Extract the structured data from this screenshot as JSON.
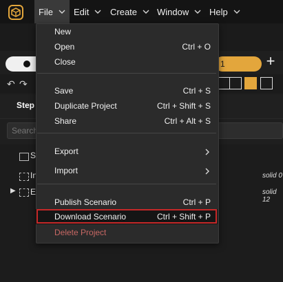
{
  "menubar": {
    "logo_icon": "app-cube-logo",
    "menus": [
      {
        "label": "File"
      },
      {
        "label": "Edit"
      },
      {
        "label": "Create"
      },
      {
        "label": "Window"
      },
      {
        "label": "Help"
      }
    ]
  },
  "background": {
    "step_tab": "Step",
    "search_placeholder": "Search",
    "orange_pill_text": "1",
    "tree_items": [
      {
        "label": "S"
      },
      {
        "label": "In"
      },
      {
        "label": "E"
      }
    ],
    "solid_labels": [
      "solid 0",
      "solid 12"
    ]
  },
  "file_menu": {
    "items": [
      {
        "label": "New",
        "shortcut": ""
      },
      {
        "label": "Open",
        "shortcut": "Ctrl + O"
      },
      {
        "label": "Close",
        "shortcut": ""
      },
      {
        "label": "Save",
        "shortcut": "Ctrl + S"
      },
      {
        "label": "Duplicate Project",
        "shortcut": "Ctrl + Shift + S"
      },
      {
        "label": "Share",
        "shortcut": "Ctrl + Alt + S"
      },
      {
        "label": "Export",
        "shortcut": ""
      },
      {
        "label": "Import",
        "shortcut": ""
      },
      {
        "label": "Publish Scenario",
        "shortcut": "Ctrl + P"
      },
      {
        "label": "Download Scenario",
        "shortcut": "Ctrl + Shift + P"
      },
      {
        "label": "Delete Project",
        "shortcut": ""
      }
    ]
  },
  "colors": {
    "accent": "#e3a63c",
    "highlight_border": "#c62828",
    "danger_text": "#c86864"
  }
}
